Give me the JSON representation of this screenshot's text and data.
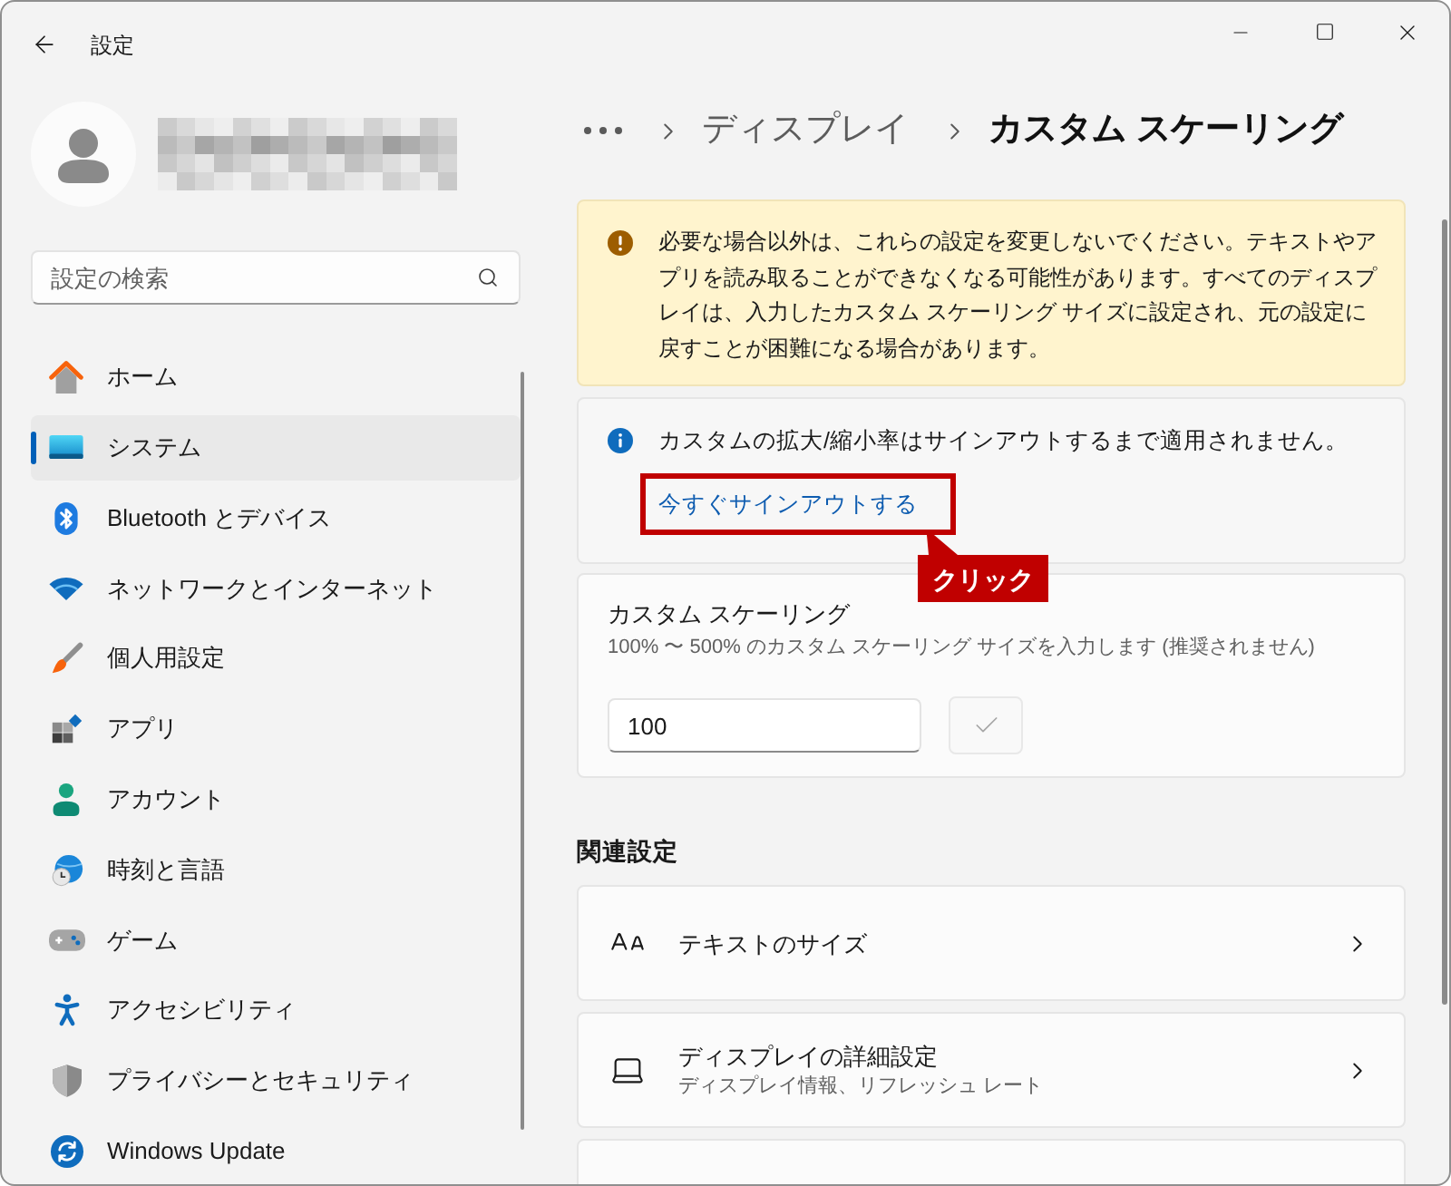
{
  "window": {
    "title": "設定"
  },
  "search": {
    "placeholder": "設定の検索"
  },
  "sidebar": {
    "items": [
      {
        "label": "ホーム",
        "selected": false
      },
      {
        "label": "システム",
        "selected": true
      },
      {
        "label": "Bluetooth とデバイス",
        "selected": false
      },
      {
        "label": "ネットワークとインターネット",
        "selected": false
      },
      {
        "label": "個人用設定",
        "selected": false
      },
      {
        "label": "アプリ",
        "selected": false
      },
      {
        "label": "アカウント",
        "selected": false
      },
      {
        "label": "時刻と言語",
        "selected": false
      },
      {
        "label": "ゲーム",
        "selected": false
      },
      {
        "label": "アクセシビリティ",
        "selected": false
      },
      {
        "label": "プライバシーとセキュリティ",
        "selected": false
      },
      {
        "label": "Windows Update",
        "selected": false
      }
    ]
  },
  "breadcrumb": [
    {
      "label": "ディスプレイ",
      "current": false
    },
    {
      "label": "カスタム スケーリング",
      "current": true
    }
  ],
  "warning": {
    "text": "必要な場合以外は、これらの設定を変更しないでください。テキストやアプリを読み取ることができなくなる可能性があります。すべてのディスプレイは、入力したカスタム スケーリング サイズに設定され、元の設定に戻すことが困難になる場合があります。"
  },
  "info": {
    "text": "カスタムの拡大/縮小率はサインアウトするまで適用されません。",
    "link": "今すぐサインアウトする"
  },
  "annotation": {
    "label": "クリック"
  },
  "custom_scaling": {
    "title": "カスタム スケーリング",
    "description": "100% 〜 500% のカスタム スケーリング サイズを入力します (推奨されません)",
    "value": "100",
    "apply_disabled": true
  },
  "related": {
    "heading": "関連設定",
    "items": [
      {
        "title": "テキストのサイズ"
      },
      {
        "title": "ディスプレイの詳細設定",
        "description": "ディスプレイ情報、リフレッシュ レート"
      }
    ]
  }
}
